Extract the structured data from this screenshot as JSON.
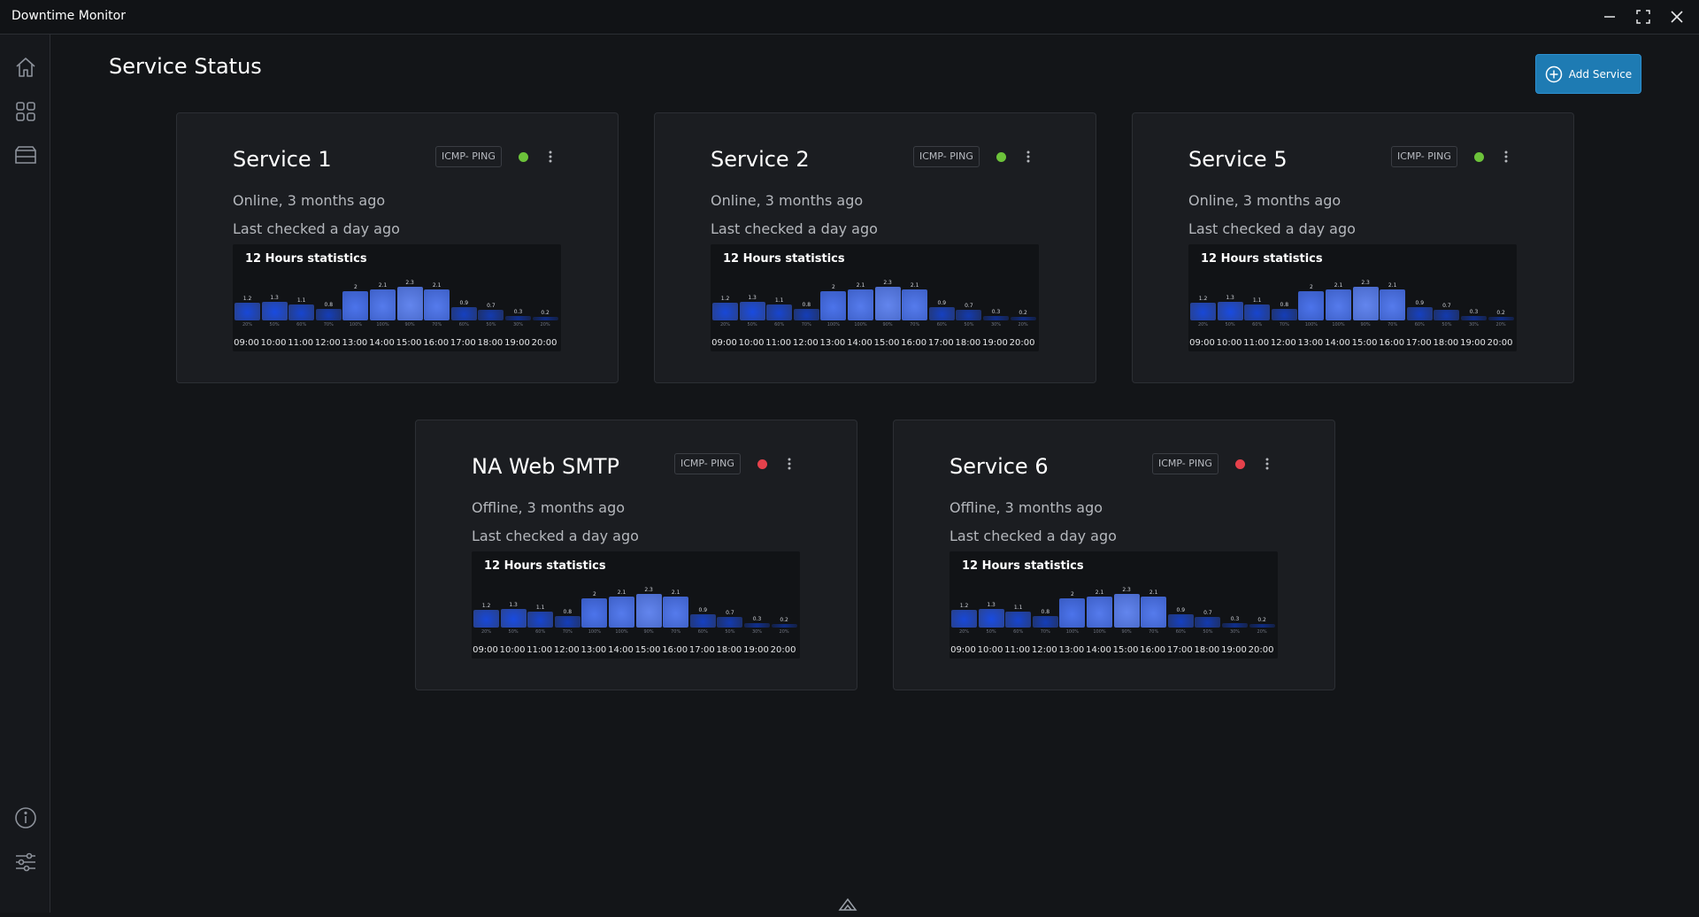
{
  "app": {
    "title": "Downtime Monitor"
  },
  "window_controls": [
    "minimize-icon",
    "maximize-icon",
    "close-icon"
  ],
  "sidebar": {
    "top_items": [
      {
        "name": "home",
        "icon": "home-icon"
      },
      {
        "name": "dashboard",
        "icon": "grid-icon"
      },
      {
        "name": "services",
        "icon": "server-icon"
      }
    ],
    "bottom_items": [
      {
        "name": "info",
        "icon": "info-icon"
      },
      {
        "name": "settings",
        "icon": "sliders-icon"
      }
    ]
  },
  "page": {
    "title": "Service Status"
  },
  "actions": {
    "add_service_label": "Add Service"
  },
  "colors": {
    "online": "#6cc23a",
    "offline": "#e5414b",
    "accent": "#1e7bb3"
  },
  "stats_template": {
    "title": "12 Hours statistics",
    "times": [
      "09:00",
      "10:00",
      "11:00",
      "12:00",
      "13:00",
      "14:00",
      "15:00",
      "16:00",
      "17:00",
      "18:00",
      "19:00",
      "20:00"
    ],
    "values": [
      "1.2",
      "1.3",
      "1.1",
      "0.8",
      "2",
      "2.1",
      "2.3",
      "2.1",
      "0.9",
      "0.7",
      "0.3",
      "0.2"
    ],
    "percents": [
      "20%",
      "50%",
      "60%",
      "70%",
      "100%",
      "100%",
      "90%",
      "70%",
      "60%",
      "50%",
      "30%",
      "20%"
    ]
  },
  "services": [
    {
      "name": "Service 1",
      "protocol": "ICMP- PING",
      "status": "online",
      "status_text": "Online, 3 months ago",
      "last_checked": "Last checked a day ago"
    },
    {
      "name": "Service 2",
      "protocol": "ICMP- PING",
      "status": "online",
      "status_text": "Online, 3 months ago",
      "last_checked": "Last checked a day ago"
    },
    {
      "name": "Service 5",
      "protocol": "ICMP- PING",
      "status": "online",
      "status_text": "Online, 3 months ago",
      "last_checked": "Last checked a day ago"
    },
    {
      "name": "NA Web SMTP",
      "protocol": "ICMP- PING",
      "status": "offline",
      "status_text": "Offline, 3 months ago",
      "last_checked": "Last checked a day ago"
    },
    {
      "name": "Service 6",
      "protocol": "ICMP- PING",
      "status": "offline",
      "status_text": "Offline, 3 months ago",
      "last_checked": "Last checked a day ago"
    }
  ]
}
